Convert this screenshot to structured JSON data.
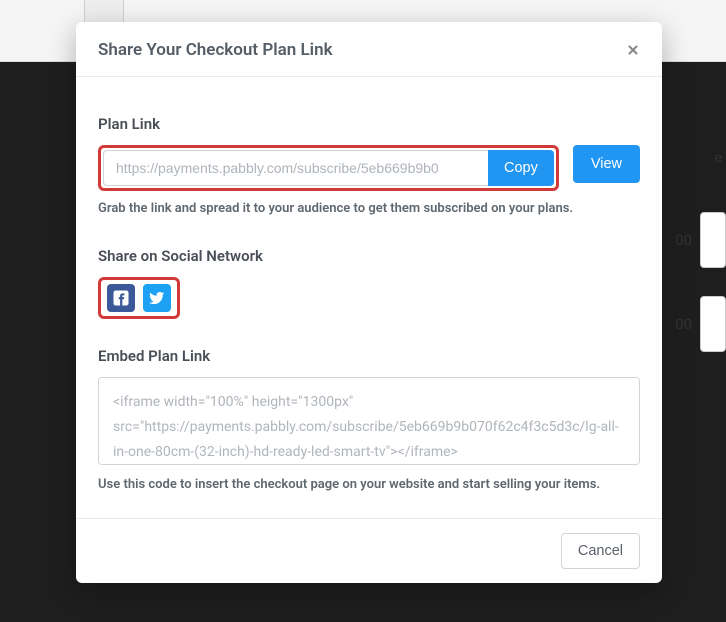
{
  "modal": {
    "title": "Share Your Checkout Plan Link",
    "plan_link": {
      "label": "Plan Link",
      "value": "https://payments.pabbly.com/subscribe/5eb669b9b0",
      "copy_label": "Copy",
      "view_label": "View",
      "helper": "Grab the link and spread it to your audience to get them subscribed on your plans."
    },
    "social": {
      "label": "Share on Social Network",
      "icons": {
        "fb": "facebook-icon",
        "tw": "twitter-icon"
      }
    },
    "embed": {
      "label": "Embed Plan Link",
      "code": "<iframe width=\"100%\" height=\"1300px\" src=\"https://payments.pabbly.com/subscribe/5eb669b9b070f62c4f3c5d3c/lg-all-in-one-80cm-(32-inch)-hd-ready-led-smart-tv\"></iframe>",
      "helper": "Use this code to insert the checkout page on your website and start selling your items."
    },
    "footer": {
      "cancel_label": "Cancel"
    }
  },
  "background": {
    "cell_you": "e",
    "row1_price": "00",
    "row2_price": "00"
  }
}
